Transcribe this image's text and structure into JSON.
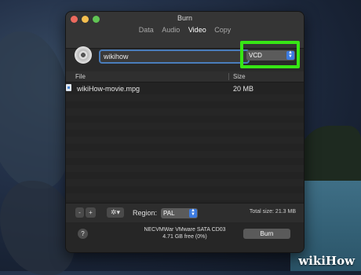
{
  "window": {
    "title": "Burn",
    "tabs": [
      {
        "label": "Data",
        "active": false
      },
      {
        "label": "Audio",
        "active": false
      },
      {
        "label": "Video",
        "active": true
      },
      {
        "label": "Copy",
        "active": false
      }
    ]
  },
  "disc_name": {
    "value": "wikihow"
  },
  "format_select": {
    "value": "VCD",
    "highlight_color": "#37e615"
  },
  "file_table": {
    "columns": [
      "File",
      "Size"
    ],
    "rows": [
      {
        "name": "wikiHow-movie.mpg",
        "size": "20 MB",
        "icon": "mpg-file-icon"
      }
    ]
  },
  "toolbar": {
    "remove_label": "-",
    "add_label": "+",
    "options_icon": "gear-icon",
    "region_label": "Region:",
    "region_value": "PAL",
    "total_size": "Total size: 21.3 MB"
  },
  "footer": {
    "help_label": "?",
    "drive_name": "NECVMWar VMware SATA CD03",
    "drive_free": "4.71 GB free (0%)",
    "burn_label": "Burn"
  },
  "watermark": {
    "part1": "wiki",
    "part2": "How"
  }
}
